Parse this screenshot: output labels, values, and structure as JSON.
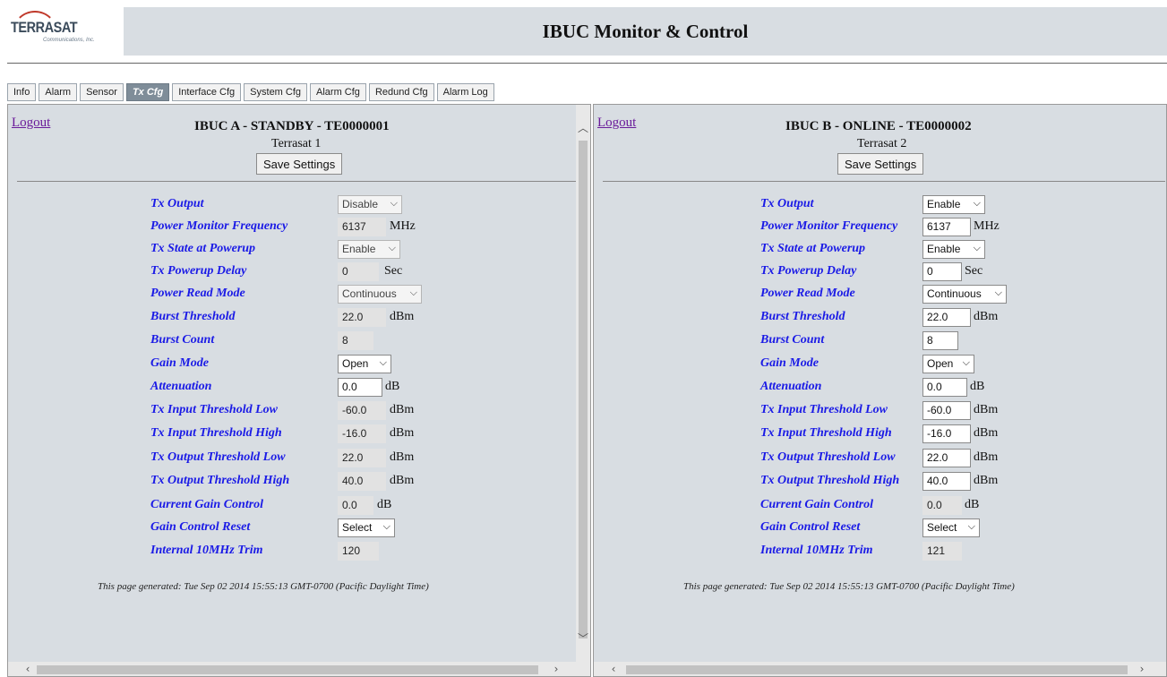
{
  "logo": {
    "text": "TERRASAT",
    "sub": "Communications, Inc."
  },
  "title": "IBUC Monitor & Control",
  "tabs": [
    {
      "label": "Info",
      "active": false
    },
    {
      "label": "Alarm",
      "active": false
    },
    {
      "label": "Sensor",
      "active": false
    },
    {
      "label": "Tx Cfg",
      "active": true
    },
    {
      "label": "Interface Cfg",
      "active": false
    },
    {
      "label": "System Cfg",
      "active": false
    },
    {
      "label": "Alarm Cfg",
      "active": false
    },
    {
      "label": "Redund Cfg",
      "active": false
    },
    {
      "label": "Alarm Log",
      "active": false
    }
  ],
  "panel_a": {
    "logout": "Logout",
    "title": "IBUC A - STANDBY - TE0000001",
    "name": "Terrasat 1",
    "save": "Save Settings",
    "fields": {
      "tx_output": {
        "label": "Tx Output",
        "value": "Disable"
      },
      "pm_freq": {
        "label": "Power Monitor Frequency",
        "value": "6137",
        "unit": "MHz"
      },
      "tx_state": {
        "label": "Tx State at Powerup",
        "value": "Enable"
      },
      "tx_delay": {
        "label": "Tx Powerup Delay",
        "value": "0",
        "unit": "Sec"
      },
      "read_mode": {
        "label": "Power Read Mode",
        "value": "Continuous"
      },
      "burst_thr": {
        "label": "Burst Threshold",
        "value": "22.0",
        "unit": "dBm"
      },
      "burst_cnt": {
        "label": "Burst Count",
        "value": "8"
      },
      "gain_mode": {
        "label": "Gain Mode",
        "value": "Open"
      },
      "atten": {
        "label": "Attenuation",
        "value": "0.0",
        "unit": "dB"
      },
      "in_low": {
        "label": "Tx Input Threshold Low",
        "value": "-60.0",
        "unit": "dBm"
      },
      "in_high": {
        "label": "Tx Input Threshold High",
        "value": "-16.0",
        "unit": "dBm"
      },
      "out_low": {
        "label": "Tx Output Threshold Low",
        "value": "22.0",
        "unit": "dBm"
      },
      "out_high": {
        "label": "Tx Output Threshold High",
        "value": "40.0",
        "unit": "dBm"
      },
      "gain_ctrl": {
        "label": "Current Gain Control",
        "value": "0.0",
        "unit": "dB"
      },
      "gain_reset": {
        "label": "Gain Control Reset",
        "value": "Select"
      },
      "trim": {
        "label": "Internal 10MHz Trim",
        "value": "120"
      }
    },
    "footer": "This page generated: Tue Sep 02 2014 15:55:13 GMT-0700 (Pacific Daylight Time)"
  },
  "panel_b": {
    "logout": "Logout",
    "title": "IBUC B - ONLINE - TE0000002",
    "name": "Terrasat 2",
    "save": "Save Settings",
    "fields": {
      "tx_output": {
        "label": "Tx Output",
        "value": "Enable"
      },
      "pm_freq": {
        "label": "Power Monitor Frequency",
        "value": "6137",
        "unit": "MHz"
      },
      "tx_state": {
        "label": "Tx State at Powerup",
        "value": "Enable"
      },
      "tx_delay": {
        "label": "Tx Powerup Delay",
        "value": "0",
        "unit": "Sec"
      },
      "read_mode": {
        "label": "Power Read Mode",
        "value": "Continuous"
      },
      "burst_thr": {
        "label": "Burst Threshold",
        "value": "22.0",
        "unit": "dBm"
      },
      "burst_cnt": {
        "label": "Burst Count",
        "value": "8"
      },
      "gain_mode": {
        "label": "Gain Mode",
        "value": "Open"
      },
      "atten": {
        "label": "Attenuation",
        "value": "0.0",
        "unit": "dB"
      },
      "in_low": {
        "label": "Tx Input Threshold Low",
        "value": "-60.0",
        "unit": "dBm"
      },
      "in_high": {
        "label": "Tx Input Threshold High",
        "value": "-16.0",
        "unit": "dBm"
      },
      "out_low": {
        "label": "Tx Output Threshold Low",
        "value": "22.0",
        "unit": "dBm"
      },
      "out_high": {
        "label": "Tx Output Threshold High",
        "value": "40.0",
        "unit": "dBm"
      },
      "gain_ctrl": {
        "label": "Current Gain Control",
        "value": "0.0",
        "unit": "dB"
      },
      "gain_reset": {
        "label": "Gain Control Reset",
        "value": "Select"
      },
      "trim": {
        "label": "Internal 10MHz Trim",
        "value": "121"
      }
    },
    "footer": "This page generated: Tue Sep 02 2014 15:55:13 GMT-0700 (Pacific Daylight Time)"
  },
  "icons": {
    "chevron": "chevron-down-icon",
    "scroll_up": "scroll-up-icon",
    "scroll_down": "scroll-down-icon",
    "scroll_left": "scroll-left-icon",
    "scroll_right": "scroll-right-icon"
  }
}
